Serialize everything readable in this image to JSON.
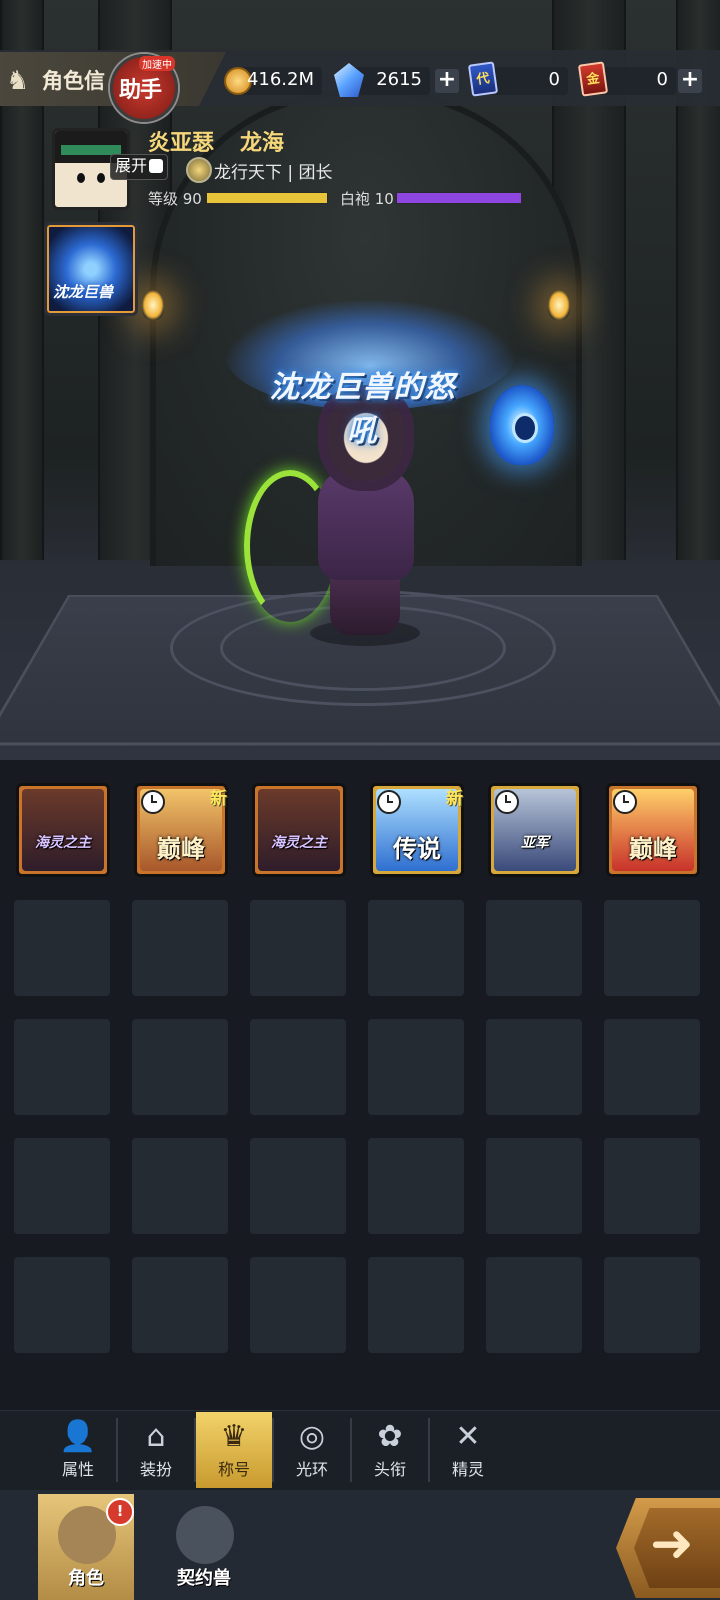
{
  "header": {
    "page_title": "角色信",
    "assist_label": "助手",
    "assist_badge": "加速中"
  },
  "resources": [
    {
      "icon": "gold-coin-icon",
      "value": "416.2M",
      "has_plus": false
    },
    {
      "icon": "diamond-icon",
      "value": "2615",
      "has_plus": true
    },
    {
      "icon": "blue-card-icon",
      "glyph": "代",
      "value": "0",
      "has_plus": false
    },
    {
      "icon": "red-card-icon",
      "glyph": "金",
      "value": "0",
      "has_plus": true
    }
  ],
  "profile": {
    "name": "炎亚瑟",
    "server": "龙海",
    "expand_label": "展开",
    "guild": "龙行天下 | 团长",
    "level_label": "等级 90",
    "level_progress": 1.0,
    "rank_label": "白袍 10",
    "rank_progress": 1.0
  },
  "pet_thumb_text": "沈龙巨兽",
  "equipped_title": "沈龙巨兽的怒吼",
  "titles": [
    {
      "text": "海灵之主",
      "timed": false,
      "new": false,
      "style": "purple"
    },
    {
      "text": "巅峰",
      "timed": true,
      "new": true,
      "style": "gold"
    },
    {
      "text": "海灵之主",
      "timed": false,
      "new": false,
      "style": "purple"
    },
    {
      "text": "传说",
      "timed": true,
      "new": true,
      "style": "blue"
    },
    {
      "text": "亚军",
      "timed": true,
      "new": false,
      "style": "silver"
    },
    {
      "text": "巅峰",
      "timed": true,
      "new": false,
      "style": "fire"
    }
  ],
  "new_tag": "新",
  "sub_tabs": [
    {
      "label": "属性",
      "icon": "person-icon"
    },
    {
      "label": "装扮",
      "icon": "hanger-icon"
    },
    {
      "label": "称号",
      "icon": "crown-icon",
      "active": true
    },
    {
      "label": "光环",
      "icon": "halo-icon"
    },
    {
      "label": "头衔",
      "icon": "emblem-icon"
    },
    {
      "label": "精灵",
      "icon": "spirit-icon"
    }
  ],
  "bottom_tabs": [
    {
      "label": "角色",
      "icon": "character-icon",
      "active": true,
      "alert": "!"
    },
    {
      "label": "契约兽",
      "icon": "paw-icon",
      "active": false
    }
  ]
}
